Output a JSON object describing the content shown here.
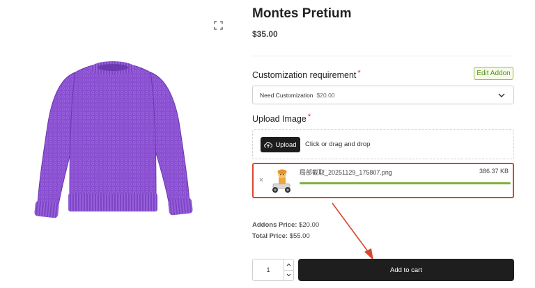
{
  "product": {
    "title": "Montes Pretium",
    "price": "$35.00",
    "image_icon": "purple-sweater-image"
  },
  "customization": {
    "label": "Customization requirement",
    "required_mark": "*",
    "edit_addon_label": "Edit Addon",
    "selected_option": "Need Customization",
    "selected_price": "$20.00"
  },
  "upload": {
    "label": "Upload Image",
    "required_mark": "*",
    "button_label": "Upload",
    "hint": "Click or drag and drop",
    "file": {
      "name": "局部截取_20251129_175807.png",
      "size": "386.37 KB",
      "remove_glyph": "×",
      "progress": 1.0
    }
  },
  "summary": {
    "addons_label": "Addons Price:",
    "addons_value": "$20.00",
    "total_label": "Total Price:",
    "total_value": "$55.00"
  },
  "cart": {
    "quantity": "1",
    "add_to_cart_label": "Add to cart"
  },
  "colors": {
    "accent_green": "#7db23a",
    "highlight_red": "#d9462d",
    "dark_button": "#1e1e1e",
    "sweater_purple": "#8a4fd1"
  }
}
